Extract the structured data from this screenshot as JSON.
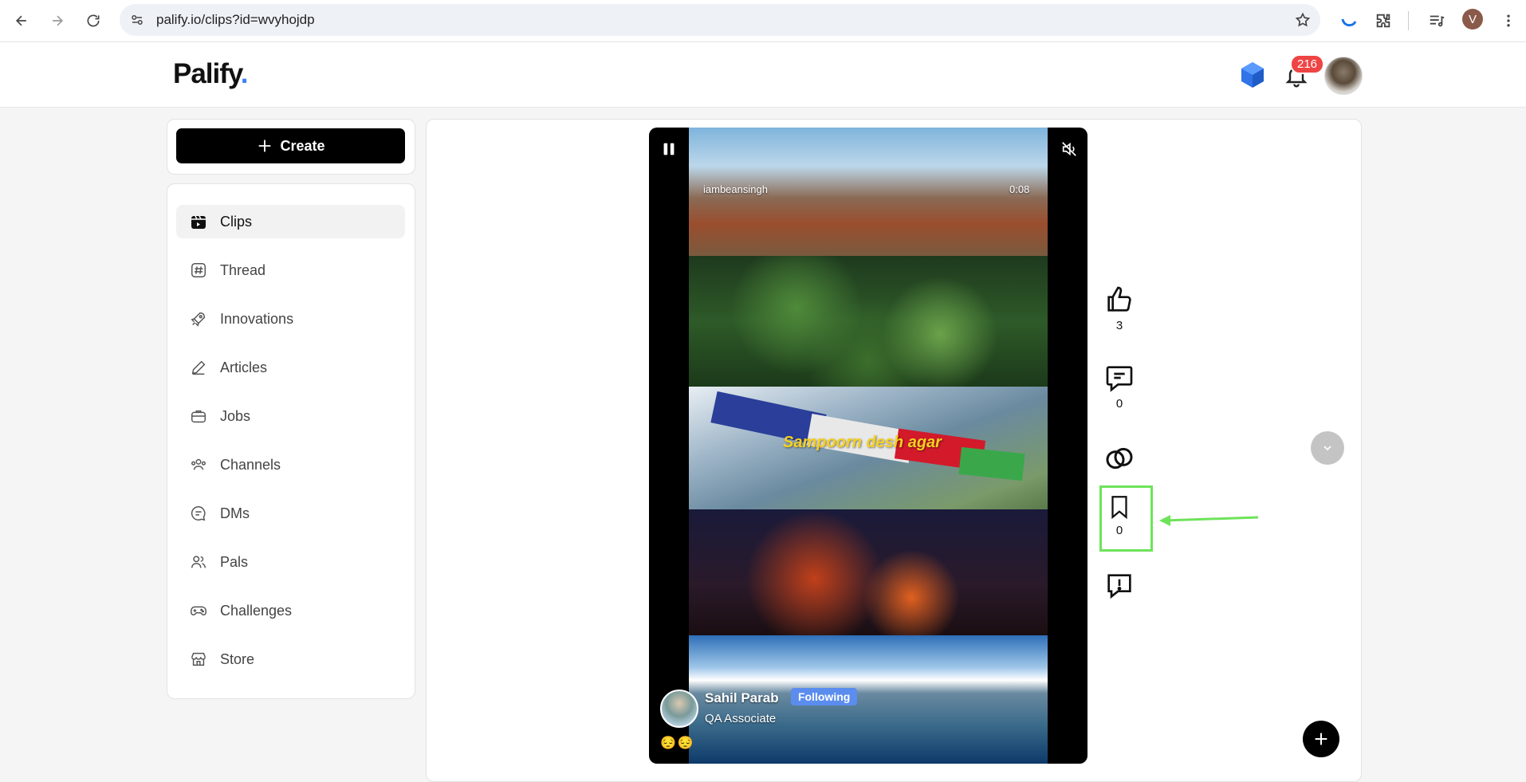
{
  "browser": {
    "url": "palify.io/clips?id=wvyhojdp",
    "profile_initial": "V"
  },
  "header": {
    "logo_text": "Palify",
    "logo_dot": ".",
    "notification_count": "216"
  },
  "sidebar": {
    "create_label": "Create",
    "items": [
      {
        "label": "Clips",
        "icon": "clips-icon",
        "active": true
      },
      {
        "label": "Thread",
        "icon": "hash-icon"
      },
      {
        "label": "Innovations",
        "icon": "rocket-icon"
      },
      {
        "label": "Articles",
        "icon": "pencil-icon"
      },
      {
        "label": "Jobs",
        "icon": "briefcase-icon"
      },
      {
        "label": "Channels",
        "icon": "users-icon"
      },
      {
        "label": "DMs",
        "icon": "chat-icon"
      },
      {
        "label": "Pals",
        "icon": "pals-icon"
      },
      {
        "label": "Challenges",
        "icon": "gamepad-icon"
      },
      {
        "label": "Store",
        "icon": "store-icon"
      }
    ]
  },
  "video": {
    "username": "iambeansingh",
    "timestamp": "0:08",
    "caption": "Sampoorn desh agar",
    "author_name": "Sahil Parab",
    "author_role": "QA Associate",
    "follow_status": "Following",
    "emojis": "😔😔"
  },
  "actions": {
    "likes": "3",
    "comments": "0",
    "saves": "0"
  },
  "colors": {
    "accent": "#3b82f6",
    "badge": "#ef4444",
    "following": "#5b8def",
    "highlight": "#6ee35a"
  }
}
